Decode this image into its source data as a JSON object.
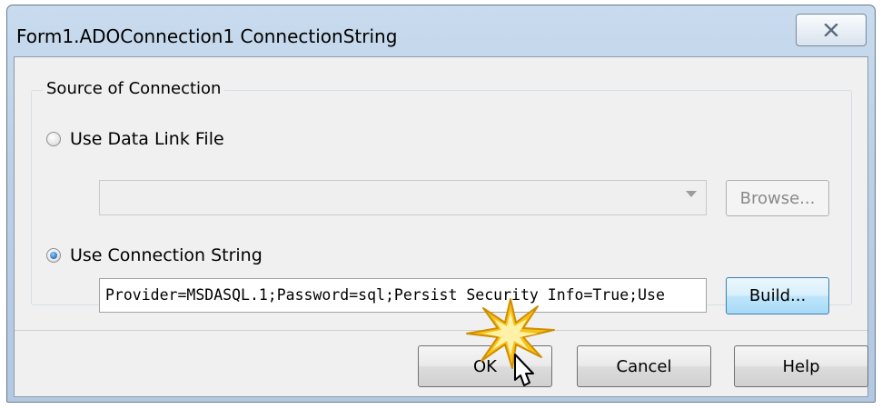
{
  "window": {
    "title": "Form1.ADOConnection1 ConnectionString"
  },
  "group": {
    "title": "Source of Connection"
  },
  "data_link": {
    "radio_label": "Use Data Link File",
    "combo_value": "",
    "browse_label": "Browse..."
  },
  "conn_string": {
    "radio_label": "Use Connection String",
    "value": "Provider=MSDASQL.1;Password=sql;Persist Security Info=True;Use",
    "build_label": "Build..."
  },
  "buttons": {
    "ok": "OK",
    "cancel": "Cancel",
    "help": "Help"
  },
  "icons": {
    "close": "close-icon",
    "dropdown": "chevron-down-icon",
    "pointer": "mouse-pointer-icon",
    "click": "click-burst-icon"
  },
  "colors": {
    "title_bar": "#bcd0e6",
    "client": "#f0f0f0",
    "hot_button": "#bee6fd",
    "burst": "#f5b800"
  }
}
